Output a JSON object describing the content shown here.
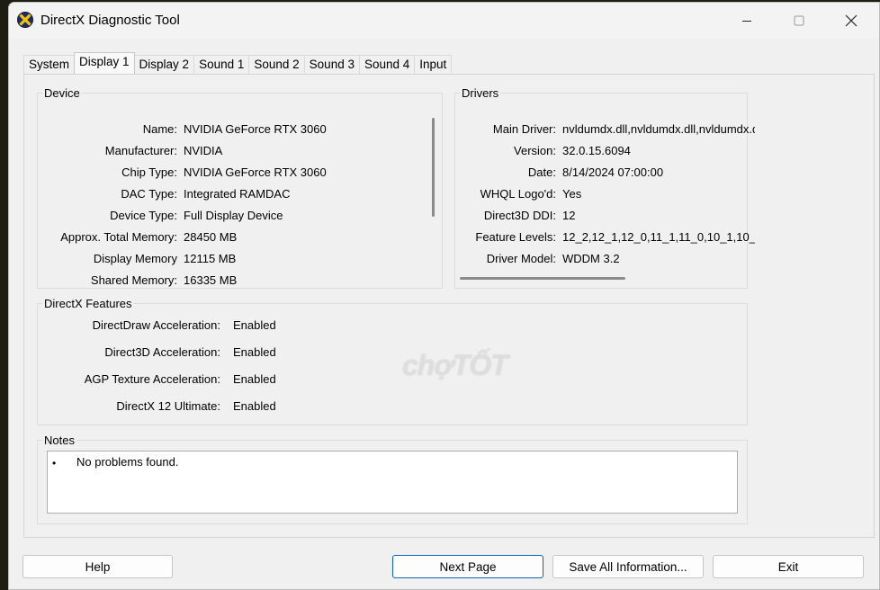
{
  "window": {
    "title": "DirectX Diagnostic Tool",
    "accent_color": "#0a66c2"
  },
  "tabs": [
    {
      "label": "System",
      "active": false
    },
    {
      "label": "Display 1",
      "active": true
    },
    {
      "label": "Display 2",
      "active": false
    },
    {
      "label": "Sound 1",
      "active": false
    },
    {
      "label": "Sound 2",
      "active": false
    },
    {
      "label": "Sound 3",
      "active": false
    },
    {
      "label": "Sound 4",
      "active": false
    },
    {
      "label": "Input",
      "active": false
    }
  ],
  "device": {
    "title": "Device",
    "rows": [
      {
        "label": "Name:",
        "value": "NVIDIA GeForce RTX 3060"
      },
      {
        "label": "Manufacturer:",
        "value": "NVIDIA"
      },
      {
        "label": "Chip Type:",
        "value": "NVIDIA GeForce RTX 3060"
      },
      {
        "label": "DAC Type:",
        "value": "Integrated RAMDAC"
      },
      {
        "label": "Device Type:",
        "value": "Full Display Device"
      },
      {
        "label": "Approx. Total Memory:",
        "value": "28450 MB"
      },
      {
        "label": "Display Memory",
        "value": "12115 MB"
      },
      {
        "label": "Shared Memory:",
        "value": "16335 MB"
      }
    ]
  },
  "drivers": {
    "title": "Drivers",
    "rows": [
      {
        "label": "Main Driver:",
        "value": "nvldumdx.dll,nvldumdx.dll,nvldumdx.d"
      },
      {
        "label": "Version:",
        "value": "32.0.15.6094"
      },
      {
        "label": "Date:",
        "value": "8/14/2024 07:00:00"
      },
      {
        "label": "WHQL Logo'd:",
        "value": "Yes"
      },
      {
        "label": "Direct3D DDI:",
        "value": "12"
      },
      {
        "label": "Feature Levels:",
        "value": "12_2,12_1,12_0,11_1,11_0,10_1,10_("
      },
      {
        "label": "Driver Model:",
        "value": "WDDM 3.2"
      }
    ]
  },
  "features": {
    "title": "DirectX Features",
    "rows": [
      {
        "label": "DirectDraw Acceleration:",
        "value": "Enabled"
      },
      {
        "label": "Direct3D Acceleration:",
        "value": "Enabled"
      },
      {
        "label": "AGP Texture Acceleration:",
        "value": "Enabled"
      },
      {
        "label": "DirectX 12 Ultimate:",
        "value": "Enabled"
      }
    ]
  },
  "notes": {
    "title": "Notes",
    "bullet": "•",
    "text": "No problems found."
  },
  "buttons": {
    "help": "Help",
    "next_page": "Next Page",
    "save_all": "Save All Information...",
    "exit": "Exit"
  },
  "watermark": "chợTỐT"
}
